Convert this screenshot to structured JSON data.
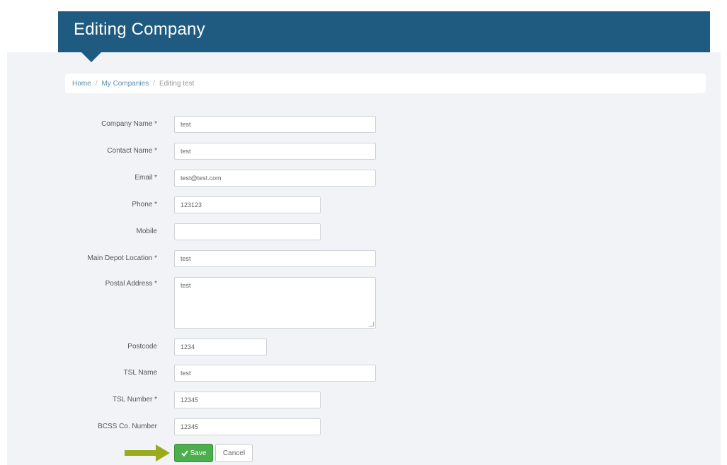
{
  "header": {
    "title": "Editing Company"
  },
  "breadcrumb": {
    "home": "Home",
    "separator": "/",
    "companies": "My Companies",
    "current": "Editing test"
  },
  "form": {
    "company_name": {
      "label": "Company Name *",
      "value": "test"
    },
    "contact_name": {
      "label": "Contact Name *",
      "value": "test"
    },
    "email": {
      "label": "Email *",
      "value": "test@test.com"
    },
    "phone": {
      "label": "Phone *",
      "value": "123123"
    },
    "mobile": {
      "label": "Mobile",
      "value": ""
    },
    "main_depot_location": {
      "label": "Main Depot Location *",
      "value": "test"
    },
    "postal_address": {
      "label": "Postal Address *",
      "value": "test"
    },
    "postcode": {
      "label": "Postcode",
      "value": "1234"
    },
    "tsl_name": {
      "label": "TSL Name",
      "value": "test"
    },
    "tsl_number": {
      "label": "TSL Number *",
      "value": "12345"
    },
    "bcss_number": {
      "label": "BCSS Co. Number",
      "value": "12345"
    }
  },
  "actions": {
    "save_label": "Save",
    "cancel_label": "Cancel"
  },
  "icons": {
    "save": "checkmark-icon",
    "annotation": "arrow-right-icon"
  },
  "colors": {
    "header": "#1f5a80",
    "save": "#4cae4c",
    "annotation_arrow": "#9aaa1e",
    "background": "#f1f3f7"
  }
}
